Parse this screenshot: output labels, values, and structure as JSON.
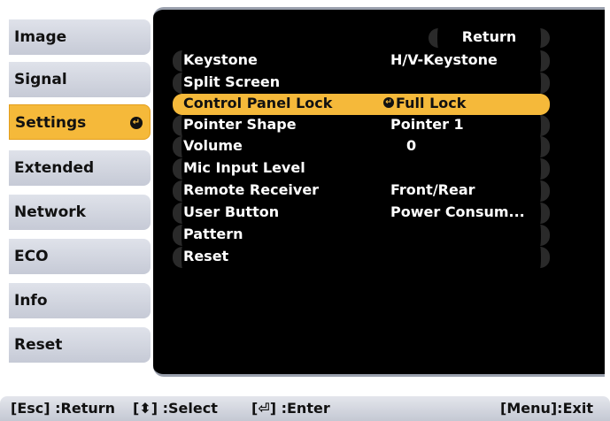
{
  "sidebar": {
    "items": [
      {
        "label": "Image"
      },
      {
        "label": "Signal"
      },
      {
        "label": "Settings"
      },
      {
        "label": "Extended"
      },
      {
        "label": "Network"
      },
      {
        "label": "ECO"
      },
      {
        "label": "Info"
      },
      {
        "label": "Reset"
      }
    ],
    "active_index": 2
  },
  "menu": {
    "return_label": "Return",
    "rows": [
      {
        "label": "Keystone",
        "value": "H/V-Keystone"
      },
      {
        "label": "Split Screen",
        "value": ""
      },
      {
        "label": "Control Panel Lock",
        "value": "Full Lock"
      },
      {
        "label": "Pointer Shape",
        "value": "Pointer 1"
      },
      {
        "label": "Volume",
        "value": "0"
      },
      {
        "label": "Mic Input Level",
        "value": ""
      },
      {
        "label": "Remote Receiver",
        "value": "Front/Rear"
      },
      {
        "label": "User Button",
        "value": "Power Consum..."
      },
      {
        "label": "Pattern",
        "value": ""
      },
      {
        "label": "Reset",
        "value": ""
      }
    ],
    "selected_index": 2
  },
  "footer": {
    "esc": "[Esc] :Return",
    "select": "[⬍] :Select",
    "enter": "[⏎] :Enter",
    "menu": "[Menu]:Exit"
  },
  "colors": {
    "highlight": "#f5b93a",
    "panel_bg": "#000000",
    "sidebar_bg": "#c6cad6"
  }
}
